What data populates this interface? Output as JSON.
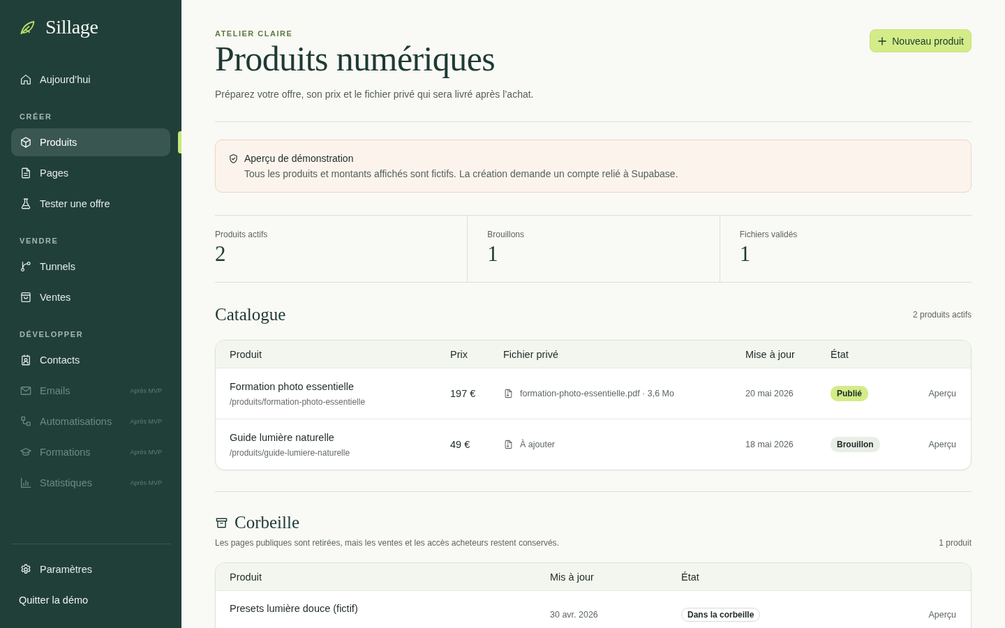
{
  "sidebar": {
    "brand": "Sillage",
    "groups": [
      {
        "items": [
          {
            "label": "Aujourd’hui",
            "selected": false,
            "disabled": false
          }
        ]
      },
      {
        "heading": "CRÉER",
        "items": [
          {
            "label": "Produits",
            "selected": true,
            "disabled": false
          },
          {
            "label": "Pages",
            "selected": false,
            "disabled": false
          },
          {
            "label": "Tester une offre",
            "selected": false,
            "disabled": false
          }
        ]
      },
      {
        "heading": "VENDRE",
        "items": [
          {
            "label": "Tunnels",
            "selected": false,
            "disabled": false
          },
          {
            "label": "Ventes",
            "selected": false,
            "disabled": false
          }
        ]
      },
      {
        "heading": "DÉVELOPPER",
        "items": [
          {
            "label": "Contacts",
            "selected": false,
            "disabled": false
          },
          {
            "label": "Emails",
            "selected": false,
            "disabled": true,
            "tag": "Après MVP"
          },
          {
            "label": "Automatisations",
            "selected": false,
            "disabled": true,
            "tag": "Après MVP"
          },
          {
            "label": "Formations",
            "selected": false,
            "disabled": true,
            "tag": "Après MVP"
          },
          {
            "label": "Statistiques",
            "selected": false,
            "disabled": true,
            "tag": "Après MVP"
          }
        ]
      }
    ],
    "footer_items": [
      {
        "label": "Paramètres",
        "selected": false,
        "disabled": false
      },
      {
        "label": "Quitter la démo",
        "selected": false,
        "disabled": false
      }
    ]
  },
  "header": {
    "eyebrow": "ATELIER CLAIRE",
    "title": "Produits numériques",
    "subtitle": "Préparez votre offre, son prix et le fichier privé qui sera livré après l’achat.",
    "action": "Nouveau produit"
  },
  "notice": {
    "title": "Aperçu de démonstration",
    "text": "Tous les produits et montants affichés sont fictifs. La création demande un compte relié à Supabase."
  },
  "stats": [
    {
      "label": "Produits actifs",
      "value": "2"
    },
    {
      "label": "Brouillons",
      "value": "1"
    },
    {
      "label": "Fichiers validés",
      "value": "1"
    }
  ],
  "catalogue": {
    "title": "Catalogue",
    "count": "2 produits actifs",
    "columns": [
      "Produit",
      "Prix",
      "Fichier privé",
      "Mise à jour",
      "État"
    ],
    "rows": [
      {
        "name": "Formation photo essentielle",
        "path": "/produits/formation-photo-essentielle",
        "price": "197 €",
        "file": "formation-photo-essentielle.pdf · 3,6 Mo",
        "updated": "20 mai 2026",
        "status": {
          "label": "Publié",
          "kind": "published"
        },
        "action": "Aperçu"
      },
      {
        "name": "Guide lumière naturelle",
        "path": "/produits/guide-lumiere-naturelle",
        "price": "49 €",
        "file": "À ajouter",
        "updated": "18 mai 2026",
        "status": {
          "label": "Brouillon",
          "kind": "draft"
        },
        "action": "Aperçu"
      }
    ]
  },
  "trash": {
    "title": "Corbeille",
    "description": "Les pages publiques sont retirées, mais les ventes et les accès acheteurs restent conservés.",
    "count": "1 produit",
    "columns": [
      "Produit",
      "Mis à jour",
      "État"
    ],
    "rows": [
      {
        "name": "Presets lumière douce (fictif)",
        "updated": "30 avr. 2026",
        "status": {
          "label": "Dans la corbeille",
          "kind": "trashed"
        },
        "action": "Aperçu"
      }
    ]
  }
}
